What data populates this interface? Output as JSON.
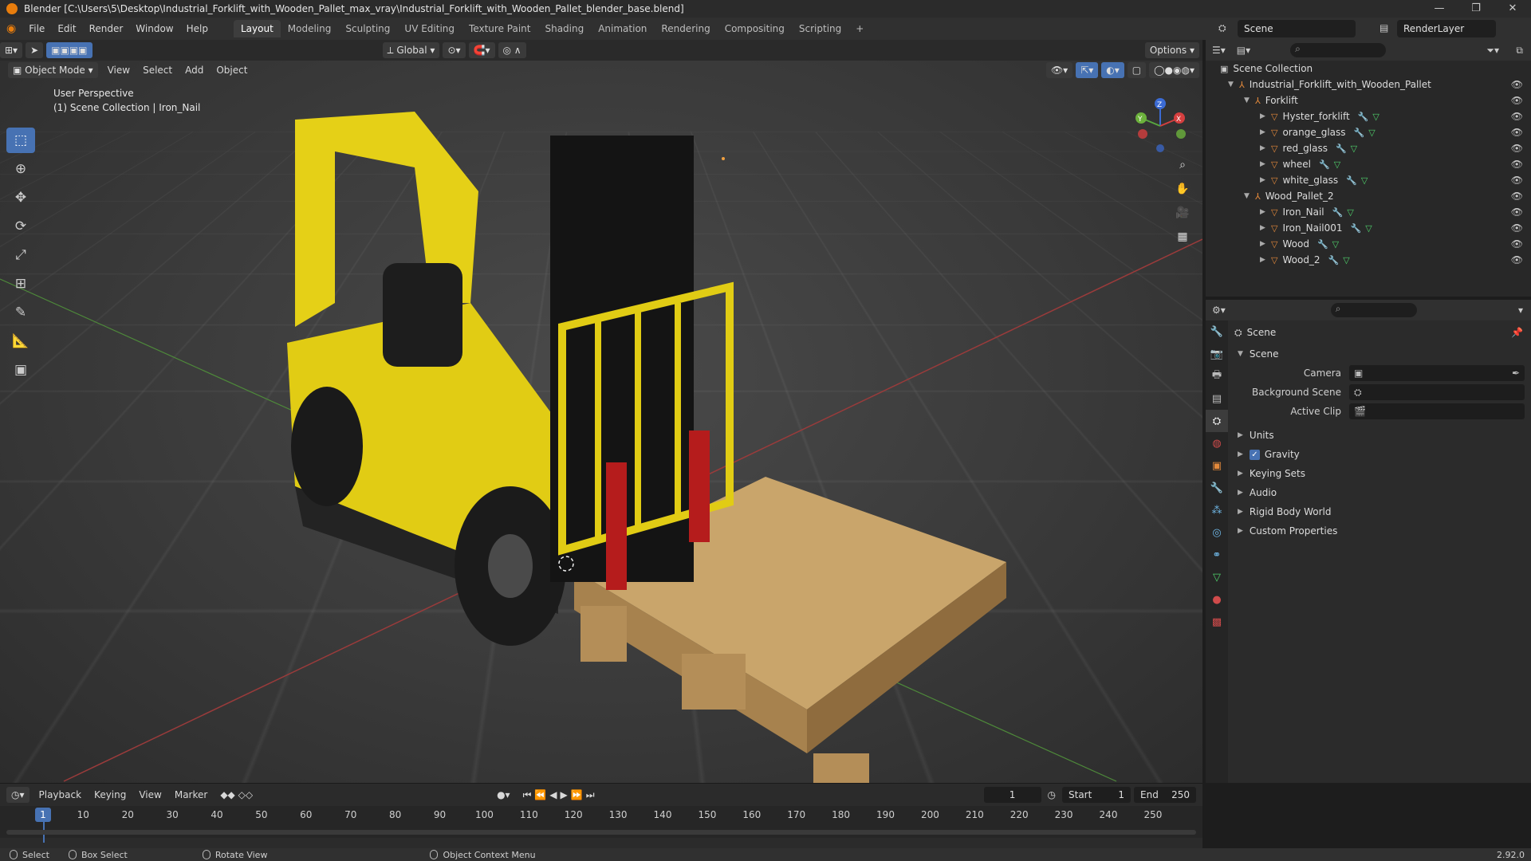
{
  "titlebar": {
    "title": "Blender [C:\\Users\\5\\Desktop\\Industrial_Forklift_with_Wooden_Pallet_max_vray\\Industrial_Forklift_with_Wooden_Pallet_blender_base.blend]",
    "minimize": "—",
    "maximize": "❐",
    "close": "✕"
  },
  "menubar": {
    "menus": [
      "File",
      "Edit",
      "Render",
      "Window",
      "Help"
    ],
    "workspaces": [
      "Layout",
      "Modeling",
      "Sculpting",
      "UV Editing",
      "Texture Paint",
      "Shading",
      "Animation",
      "Rendering",
      "Compositing",
      "Scripting"
    ],
    "add_workspace": "+",
    "scene_name": "Scene",
    "view_layer": "RenderLayer"
  },
  "viewport_header": {
    "transform_orientation": "Global",
    "options_label": "Options",
    "mode": "Object Mode",
    "menus": [
      "View",
      "Select",
      "Add",
      "Object"
    ]
  },
  "viewport": {
    "perspective_label": "User Perspective",
    "collection_label": "(1) Scene Collection | Iron_Nail",
    "gizmo_axes": {
      "x": "X",
      "y": "Y",
      "z": "Z"
    },
    "tools": [
      "select-box",
      "cursor",
      "move",
      "rotate",
      "scale",
      "transform",
      "annotate",
      "measure",
      "add-cube"
    ]
  },
  "outliner": {
    "root": "Scene Collection",
    "items": [
      {
        "label": "Industrial_Forklift_with_Wooden_Pallet",
        "depth": 0,
        "type": "collection"
      },
      {
        "label": "Forklift",
        "depth": 1,
        "type": "collection"
      },
      {
        "label": "Hyster_forklift",
        "depth": 2,
        "type": "object"
      },
      {
        "label": "orange_glass",
        "depth": 2,
        "type": "object"
      },
      {
        "label": "red_glass",
        "depth": 2,
        "type": "object"
      },
      {
        "label": "wheel",
        "depth": 2,
        "type": "object"
      },
      {
        "label": "white_glass",
        "depth": 2,
        "type": "object"
      },
      {
        "label": "Wood_Pallet_2",
        "depth": 1,
        "type": "collection"
      },
      {
        "label": "Iron_Nail",
        "depth": 2,
        "type": "object"
      },
      {
        "label": "Iron_Nail001",
        "depth": 2,
        "type": "object"
      },
      {
        "label": "Wood",
        "depth": 2,
        "type": "object"
      },
      {
        "label": "Wood_2",
        "depth": 2,
        "type": "object"
      }
    ]
  },
  "properties": {
    "context_title": "Scene",
    "panel_title": "Scene",
    "fields": [
      {
        "label": "Camera",
        "value": ""
      },
      {
        "label": "Background Scene",
        "value": ""
      },
      {
        "label": "Active Clip",
        "value": ""
      }
    ],
    "sections": [
      "Units",
      "Gravity",
      "Keying Sets",
      "Audio",
      "Rigid Body World",
      "Custom Properties"
    ],
    "gravity_checked": true
  },
  "timeline": {
    "menus": [
      "Playback",
      "Keying",
      "View",
      "Marker"
    ],
    "current_frame": "1",
    "start_label": "Start",
    "start_value": "1",
    "end_label": "End",
    "end_value": "250",
    "ruler": [
      "1",
      "10",
      "20",
      "30",
      "40",
      "50",
      "60",
      "70",
      "80",
      "90",
      "100",
      "110",
      "120",
      "130",
      "140",
      "150",
      "160",
      "170",
      "180",
      "190",
      "200",
      "210",
      "220",
      "230",
      "240",
      "250"
    ]
  },
  "statusbar": {
    "select": "Select",
    "box_select": "Box Select",
    "rotate_view": "Rotate View",
    "context_menu": "Object Context Menu",
    "version": "2.92.0"
  }
}
